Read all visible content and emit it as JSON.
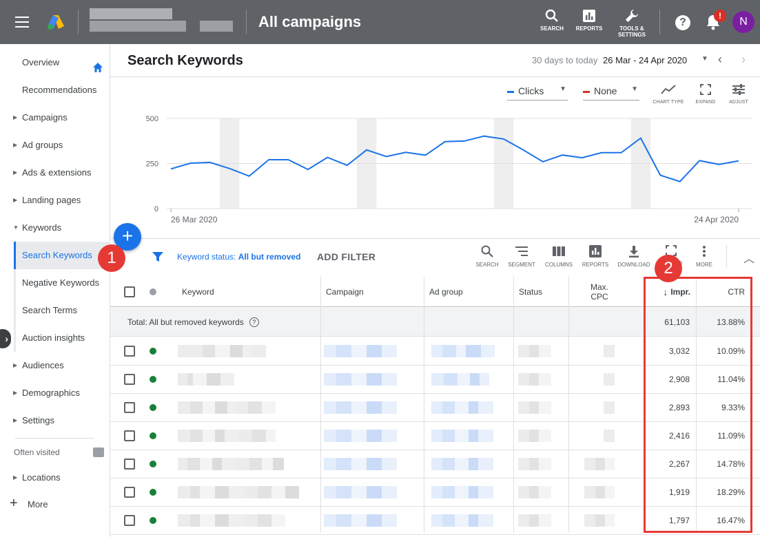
{
  "topbar": {
    "title": "All campaigns",
    "buttons": [
      {
        "label": "SEARCH",
        "icon": "search-icon"
      },
      {
        "label": "REPORTS",
        "icon": "reports-icon"
      },
      {
        "label": "TOOLS &\nSETTINGS",
        "icon": "wrench-icon"
      }
    ],
    "help_glyph": "?",
    "notification_badge": "!",
    "avatar_initial": "N"
  },
  "sidebar": {
    "items": [
      {
        "label": "Overview",
        "has_caret": false
      },
      {
        "label": "Recommendations",
        "has_caret": false
      },
      {
        "label": "Campaigns",
        "has_caret": true
      },
      {
        "label": "Ad groups",
        "has_caret": true
      },
      {
        "label": "Ads & extensions",
        "has_caret": true
      },
      {
        "label": "Landing pages",
        "has_caret": true
      },
      {
        "label": "Keywords",
        "has_caret": true,
        "expanded": true
      },
      {
        "label": "Search Keywords",
        "active": true
      },
      {
        "label": "Negative Keywords"
      },
      {
        "label": "Search Terms"
      },
      {
        "label": "Auction insights"
      },
      {
        "label": "Audiences",
        "has_caret": true
      },
      {
        "label": "Demographics",
        "has_caret": true
      },
      {
        "label": "Settings",
        "has_caret": true
      }
    ],
    "often_visited_label": "Often visited",
    "locations_label": "Locations",
    "more_label": "More"
  },
  "header": {
    "page_title": "Search Keywords",
    "range_label": "30 days to today",
    "range_value": "26 Mar - 24 Apr 2020"
  },
  "chart": {
    "metric1": "Clicks",
    "metric2": "None",
    "metric1_color": "#1a73e8",
    "metric2_color": "#d93025",
    "tools": [
      "CHART TYPE",
      "EXPAND",
      "ADJUST"
    ]
  },
  "chart_data": {
    "type": "line",
    "series": [
      {
        "name": "Clicks",
        "values": [
          220,
          252,
          256,
          222,
          180,
          271,
          271,
          217,
          284,
          240,
          325,
          289,
          312,
          296,
          371,
          375,
          402,
          386,
          325,
          260,
          297,
          282,
          310,
          310,
          391,
          185,
          150,
          266,
          245,
          265
        ]
      }
    ],
    "ylim": [
      0,
      500
    ],
    "yticks": [
      "500",
      "250",
      "0"
    ],
    "xtick_labels": [
      "26 Mar 2020",
      "24 Apr 2020"
    ],
    "weekend_bands": [
      3,
      10,
      17,
      24
    ],
    "grid": true
  },
  "toolbar": {
    "fab_glyph": "+",
    "filter_prefix": "Keyword status: ",
    "filter_value": "All but removed",
    "add_filter": "ADD FILTER",
    "tools": [
      "SEARCH",
      "SEGMENT",
      "COLUMNS",
      "REPORTS",
      "DOWNLOAD",
      "EXPAND",
      "MORE"
    ]
  },
  "annotations": {
    "badge1": "1",
    "badge2": "2"
  },
  "table": {
    "headers": {
      "keyword": "Keyword",
      "campaign": "Campaign",
      "ad_group": "Ad group",
      "status": "Status",
      "max_cpc": "Max.\nCPC",
      "impr": "Impr.",
      "ctr": "CTR"
    },
    "sort_arrow": "↓",
    "total_label": "Total: All but removed keywords",
    "total_impr": "61,103",
    "total_ctr": "13.88%",
    "rows": [
      {
        "impr": "3,032",
        "ctr": "10.09%"
      },
      {
        "impr": "2,908",
        "ctr": "11.04%"
      },
      {
        "impr": "2,893",
        "ctr": "9.33%"
      },
      {
        "impr": "2,416",
        "ctr": "11.09%"
      },
      {
        "impr": "2,267",
        "ctr": "14.78%"
      },
      {
        "impr": "1,919",
        "ctr": "18.29%"
      },
      {
        "impr": "1,797",
        "ctr": "16.47%"
      }
    ]
  }
}
